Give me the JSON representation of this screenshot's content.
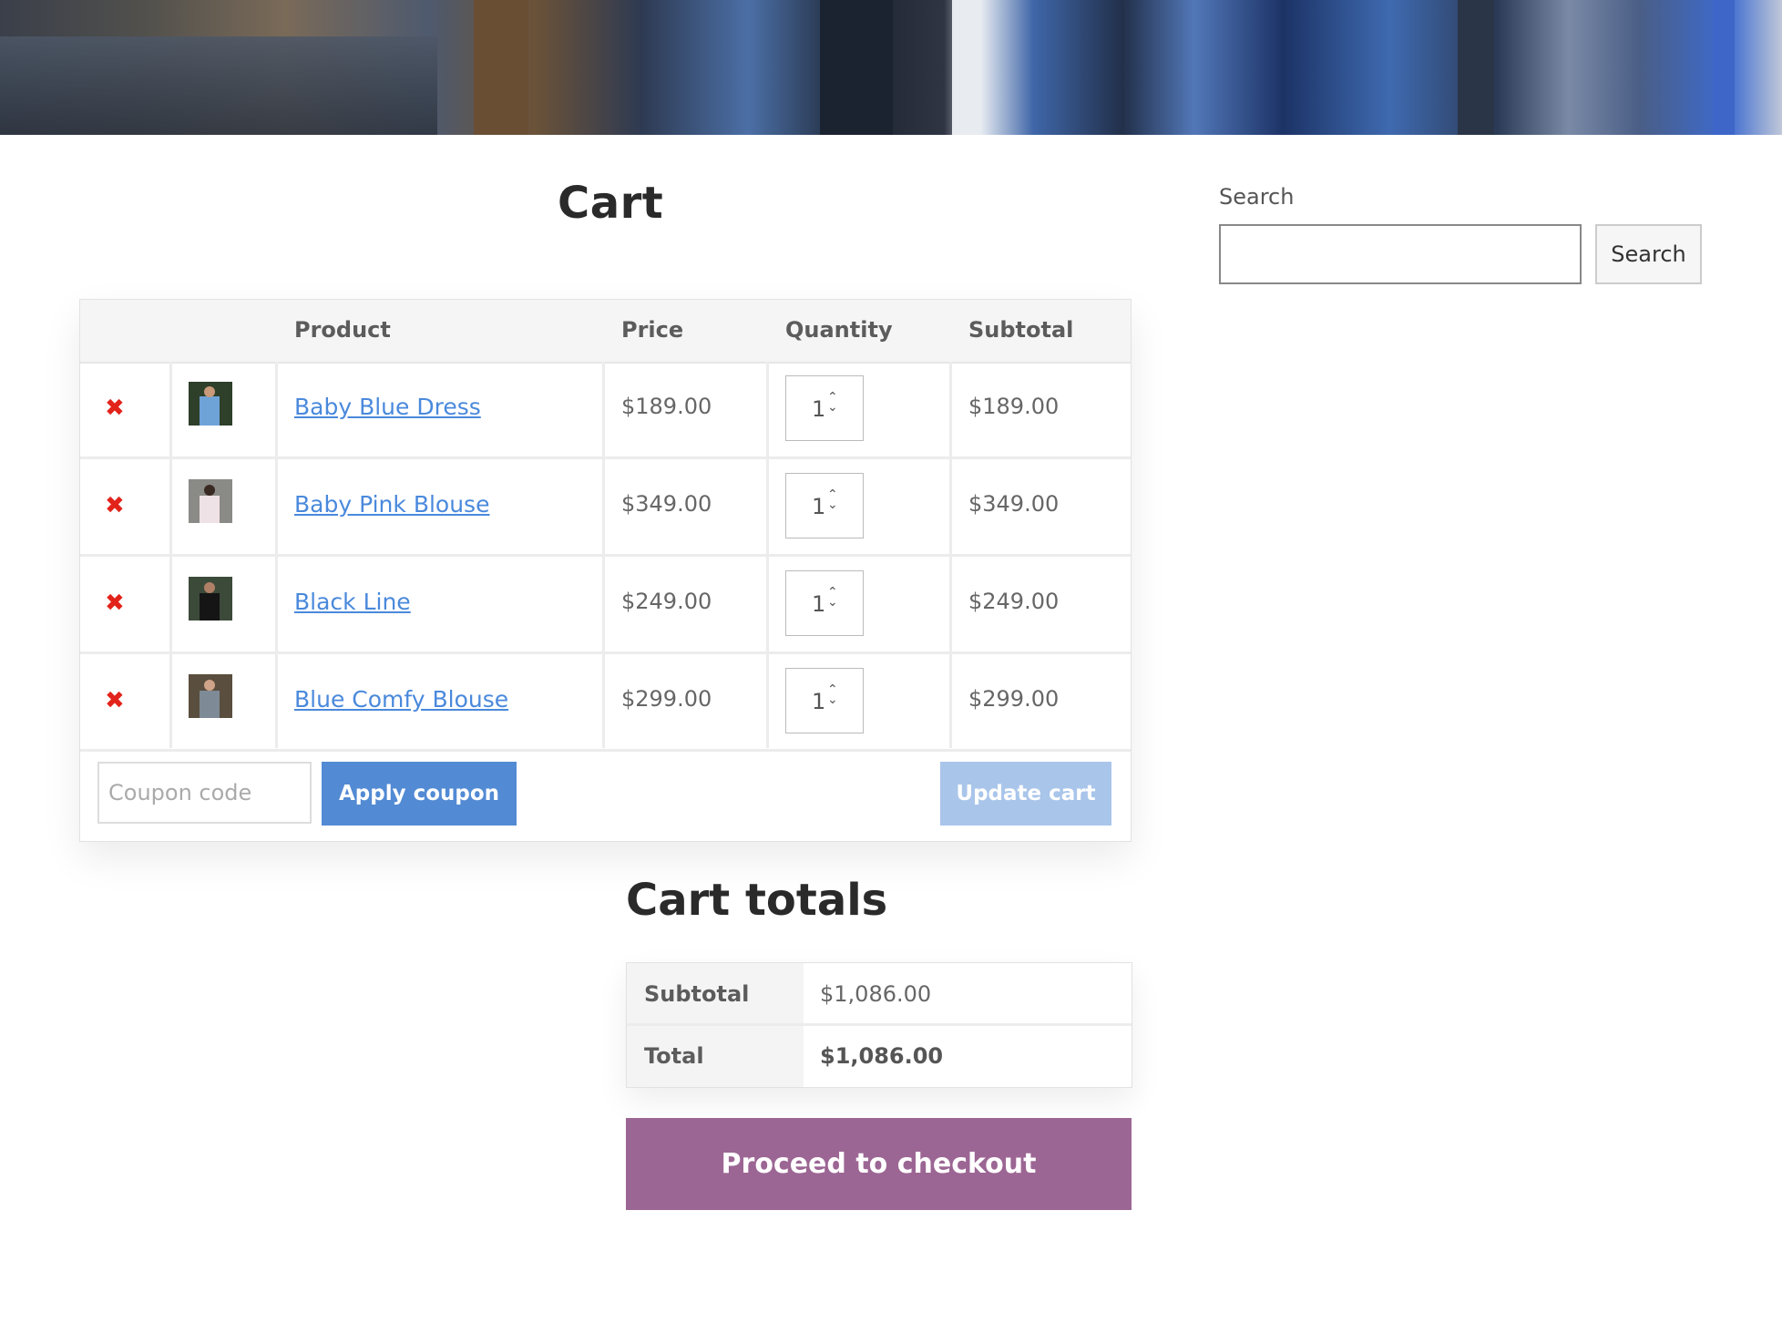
{
  "page": {
    "title": "Cart"
  },
  "cart": {
    "headers": [
      "",
      "",
      "Product",
      "Price",
      "Quantity",
      "Subtotal"
    ],
    "remove_symbol": "✖",
    "items": [
      {
        "name": "Baby Blue Dress",
        "price": "$189.00",
        "quantity": "1",
        "subtotal": "$189.00"
      },
      {
        "name": "Baby Pink Blouse",
        "price": "$349.00",
        "quantity": "1",
        "subtotal": "$349.00"
      },
      {
        "name": "Black Line",
        "price": "$249.00",
        "quantity": "1",
        "subtotal": "$249.00"
      },
      {
        "name": "Blue Comfy Blouse",
        "price": "$299.00",
        "quantity": "1",
        "subtotal": "$299.00"
      }
    ],
    "coupon": {
      "placeholder": "Coupon code",
      "apply_label": "Apply coupon"
    },
    "update_label": "Update cart"
  },
  "totals": {
    "title": "Cart totals",
    "subtotal_label": "Subtotal",
    "subtotal_value": "$1,086.00",
    "total_label": "Total",
    "total_value": "$1,086.00",
    "checkout_label": "Proceed to checkout"
  },
  "sidebar": {
    "search_label": "Search",
    "search_button": "Search"
  },
  "colors": {
    "accent_blue": "#528ad4",
    "update_disabled": "#a9c5ea",
    "checkout_purple": "#9c6694",
    "remove_red": "#e2231a",
    "link_blue": "#4a89dc"
  },
  "icons": {
    "remove": "remove-icon",
    "spinner": "quantity-spinner-icon"
  }
}
